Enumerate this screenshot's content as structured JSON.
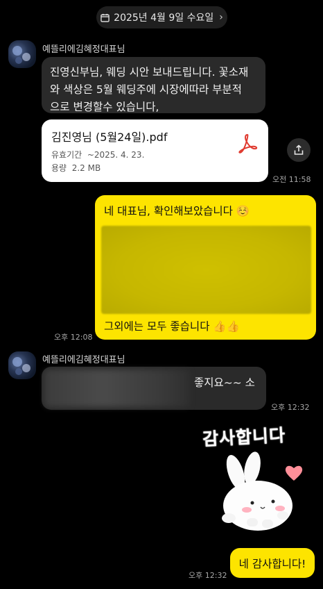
{
  "date_divider": {
    "label": "2025년 4월 9일 수요일"
  },
  "messages": {
    "m1": {
      "sender": "예뜰리에김혜정대표님",
      "text_lines": [
        "진영신부님, 웨딩 시안 보내드립니다. 꽃소재",
        "와 색상은 5월 웨딩주에 시장에따라 부분적",
        "으로 변경할수 있습니다,"
      ]
    },
    "file": {
      "name": "김진영님 (5월24일).pdf",
      "validity_label": "유효기간",
      "validity_value": "~2025. 4. 23.",
      "size_label": "용량",
      "size_value": "2.2 MB",
      "time": "오전 11:58"
    },
    "m2": {
      "text": "네 대표님, 확인해보았습니다 ☺️",
      "caption": "그외에는 모두 좋습니다 👍👍",
      "time": "오후 12:08"
    },
    "m3": {
      "sender": "예뜰리에김혜정대표님",
      "text": "좋지요~~  소",
      "time": "오후 12:32"
    },
    "sticker": {
      "text": "감사합니다"
    },
    "m4": {
      "text": "네 감사합니다!",
      "time": "오후 12:32"
    }
  },
  "colors": {
    "bg": "#000000",
    "dark_bubble": "#2a2a2a",
    "yellow_bubble": "#fde400",
    "file_icon": "#e03a2f"
  },
  "icons": [
    "calendar-icon",
    "chevron-right-icon",
    "pdf-icon",
    "share-icon",
    "heart-icon"
  ]
}
